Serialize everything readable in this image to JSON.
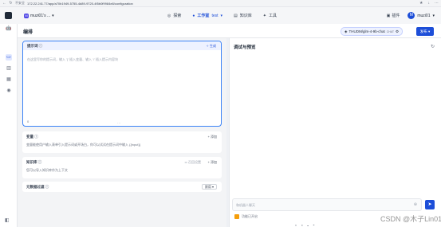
{
  "browser": {
    "security": "不安全",
    "url": "172.22.241.77/app/a70b1949-5755-4d89-9720-4f5b0f9984e8/configuration",
    "right_icons": [
      "★",
      "↓",
      "⋯"
    ]
  },
  "header": {
    "workspace_initial": "M",
    "workspace_name": "muzi01's ...",
    "nav": [
      {
        "label": "探索"
      },
      {
        "label": "工作室",
        "sub": "test"
      },
      {
        "label": "知识库"
      },
      {
        "label": "工具"
      }
    ],
    "plugin_label": "插件",
    "user_initial": "M",
    "user_name": "muzi01"
  },
  "toolbar": {
    "title": "编排",
    "model": "THUDM/glm-4-9b-chat",
    "model_tag": "CHAT",
    "publish": "发布"
  },
  "prompt": {
    "title": "提示词",
    "generate": "生成",
    "placeholder": "在这里写你的提示词，输入 '{' 插入变量、输入 '/' 插入提示内容块",
    "count": "0"
  },
  "variables": {
    "title": "变量",
    "add": "+ 添加",
    "desc": "变量能使用户输入表单引入提示词或开场白，你可以试试在提示词中输入 {{input}}"
  },
  "context": {
    "title": "知识库",
    "recall": "召回设置",
    "add": "+ 添加",
    "desc": "您可以导入知识库作为上下文"
  },
  "metadata": {
    "title": "元数据过滤",
    "select": "禁用"
  },
  "debug": {
    "title": "调试与预览",
    "input_placeholder": "和机器人聊天",
    "feature": "功能已开启"
  },
  "watermark": "CSDN @木子Lin01"
}
